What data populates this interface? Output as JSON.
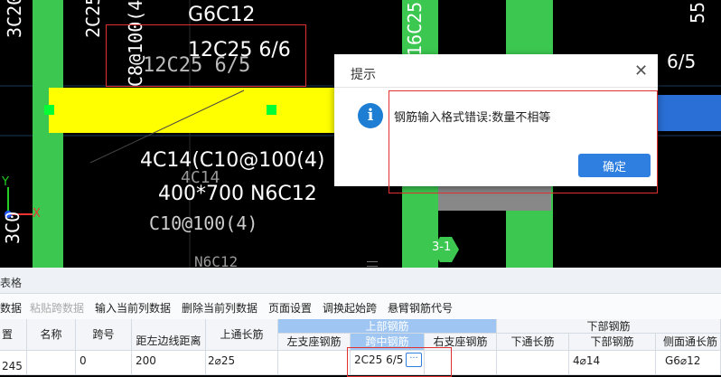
{
  "cad": {
    "top_left_vertical_text": "3C20",
    "top_vertical_text_2": "2C25",
    "top_vertical_text_3": "C8@100(4",
    "top_vertical_text_4": "16C25",
    "top_vertical_text_5": "55",
    "label_g6c12": "G6C12",
    "label_12c25": "12C25 6/6",
    "label_12c25_faint": "12C25 6/5",
    "label_right_partial": "6/5",
    "label_4c14": "4C14(C10@100(4)",
    "label_400x700": "400*700 N6C12",
    "label_4c14_faint": "4C14",
    "label_c10": "C10@100(4)",
    "label_n6c12_faint": "N6C12",
    "label_axis": "3-1",
    "left_vertical_bottom": "3C0",
    "axis_x": "X",
    "axis_y": "Y",
    "colors": {
      "beam_yellow": "#ffff00",
      "column_green": "#3cc850",
      "beam_blue": "#2a6fd6",
      "grid_line": "#1a3a5a"
    }
  },
  "dialog": {
    "title": "提示",
    "close_glyph": "✕",
    "icon_glyph": "i",
    "message": "钢筋输入格式错误:数量不相等",
    "ok_label": "确定"
  },
  "panel": {
    "title": "表格",
    "toolbar": [
      {
        "label": "数据",
        "disabled": false
      },
      {
        "label": "粘贴跨数据",
        "disabled": true
      },
      {
        "label": "输入当前列数据",
        "disabled": false
      },
      {
        "label": "删除当前列数据",
        "disabled": false
      },
      {
        "label": "页面设置",
        "disabled": false
      },
      {
        "label": "调换起始跨",
        "disabled": false
      },
      {
        "label": "悬臂钢筋代号",
        "disabled": false
      }
    ],
    "headers": {
      "col0": "置",
      "name": "名称",
      "span_no": "跨号",
      "edge_dist": "距左边线距离",
      "top_through": "上通长筋",
      "upper_group": "上部钢筋",
      "left_support": "左支座钢筋",
      "mid_span": "跨中钢筋",
      "right_support": "右支座钢筋",
      "lower_group": "下部钢筋",
      "bottom_through": "下通长筋",
      "bottom_bar": "下部钢筋",
      "side_through": "侧面通长筋"
    },
    "row": {
      "col0": "245",
      "name": "",
      "span_no": "0",
      "edge_dist": "200",
      "top_through": "2⌀25",
      "left_support": "",
      "mid_span": "2C25 6/5",
      "mid_span_more": "···",
      "right_support": "",
      "bottom_through": "",
      "bottom_bar": "4⌀14",
      "side_through": "G6⌀12"
    }
  }
}
